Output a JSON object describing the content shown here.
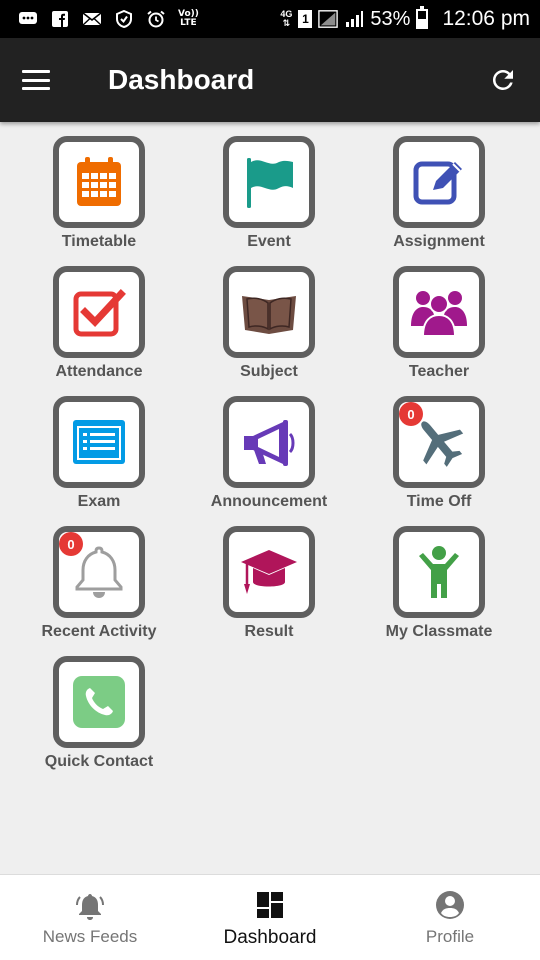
{
  "status_bar": {
    "network": "4G",
    "sim": "1",
    "volte_top": "Vo))",
    "volte_bottom": "LTE",
    "battery": "53%",
    "time": "12:06 pm"
  },
  "app_bar": {
    "title": "Dashboard"
  },
  "tiles": [
    {
      "label": "Timetable"
    },
    {
      "label": "Event"
    },
    {
      "label": "Assignment"
    },
    {
      "label": "Attendance"
    },
    {
      "label": "Subject"
    },
    {
      "label": "Teacher"
    },
    {
      "label": "Exam"
    },
    {
      "label": "Announcement"
    },
    {
      "label": "Time Off",
      "badge": "0"
    },
    {
      "label": "Recent Activity",
      "badge": "0"
    },
    {
      "label": "Result"
    },
    {
      "label": "My Classmate"
    },
    {
      "label": "Quick Contact"
    }
  ],
  "bottom_nav": {
    "items": [
      {
        "label": "News Feeds",
        "icon": "bell-icon"
      },
      {
        "label": "Dashboard",
        "icon": "dashboard-icon",
        "active": true
      },
      {
        "label": "Profile",
        "icon": "account-circle-icon"
      }
    ]
  },
  "colors": {
    "app_bar": "#222222",
    "background": "#efefef",
    "tile_border": "#5f5f5f",
    "badge": "#e53935"
  }
}
